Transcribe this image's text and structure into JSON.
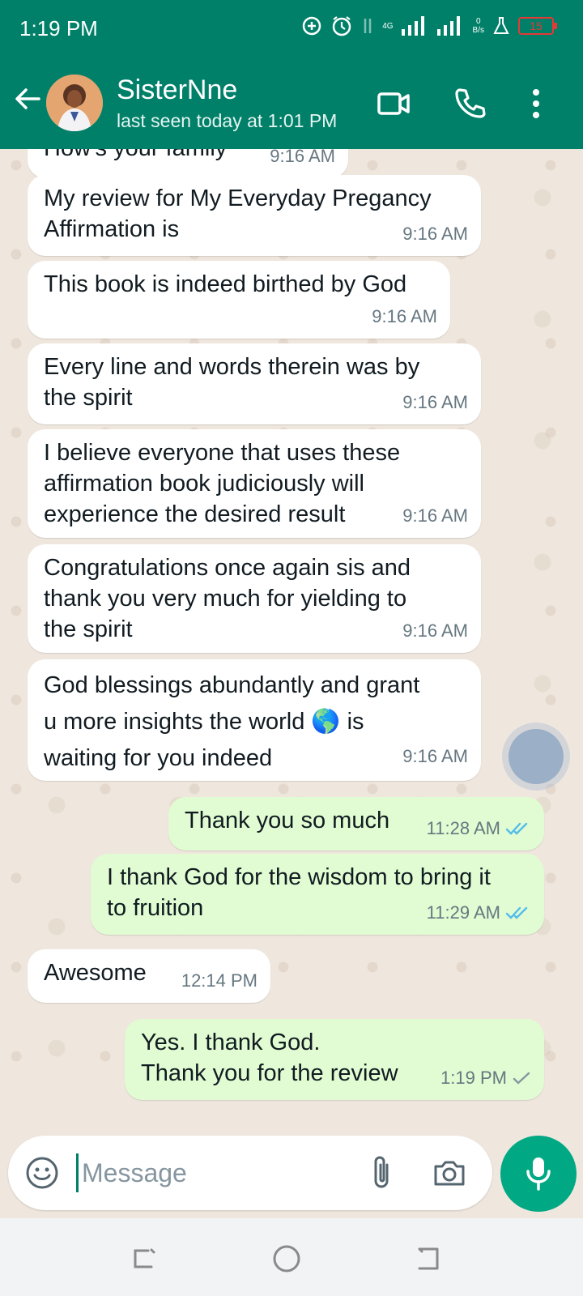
{
  "status_bar": {
    "time": "1:19 PM",
    "network": "4G",
    "speed_value": "0",
    "speed_unit": "B/s",
    "battery": "15",
    "colors": {
      "battery_low": "#e53935"
    }
  },
  "header": {
    "contact_name": "SisterNne",
    "contact_status": "last seen today at 1:01 PM",
    "icons": [
      "back-arrow-icon",
      "video-call-icon",
      "voice-call-icon",
      "more-options-icon"
    ],
    "colors": {
      "brand": "#008069"
    }
  },
  "messages": [
    {
      "direction": "in",
      "text": "How's your family",
      "time": "9:16 AM"
    },
    {
      "direction": "in",
      "text": "My review for My Everyday Pregancy\nAffirmation is",
      "time": "9:16 AM"
    },
    {
      "direction": "in",
      "text": "This book is indeed birthed by God",
      "time": "9:16 AM"
    },
    {
      "direction": "in",
      "text": "Every line and words therein was by\nthe spirit",
      "time": "9:16 AM"
    },
    {
      "direction": "in",
      "text": "I believe everyone that uses these\naffirmation book judiciously will\nexperience the desired result",
      "time": "9:16 AM"
    },
    {
      "direction": "in",
      "text": "Congratulations once again sis and\nthank you very much for yielding to\nthe spirit",
      "time": "9:16 AM"
    },
    {
      "direction": "in",
      "text": "God blessings abundantly and grant\nu more insights the world 🌎 is\nwaiting for you indeed",
      "time": "9:16 AM"
    },
    {
      "direction": "out",
      "text": "Thank you so much",
      "time": "11:28 AM",
      "status": "read"
    },
    {
      "direction": "out",
      "text": "I thank God for the wisdom to bring it\nto fruition",
      "time": "11:29 AM",
      "status": "read"
    },
    {
      "direction": "in",
      "text": "Awesome",
      "time": "12:14 PM"
    },
    {
      "direction": "out",
      "text": "Yes. I thank God.\nThank you for the review",
      "time": "1:19 PM",
      "status": "sent"
    }
  ],
  "composer": {
    "placeholder": "Message",
    "value": "",
    "icons": [
      "emoji-icon",
      "attach-icon",
      "camera-icon",
      "mic-icon"
    ],
    "colors": {
      "accent": "#00a884",
      "outgoing_bubble": "#e1fcd2",
      "read_ticks": "#53bdeb"
    }
  },
  "nav_bar": {
    "icons": [
      "recents-icon",
      "home-icon",
      "back-icon"
    ]
  }
}
